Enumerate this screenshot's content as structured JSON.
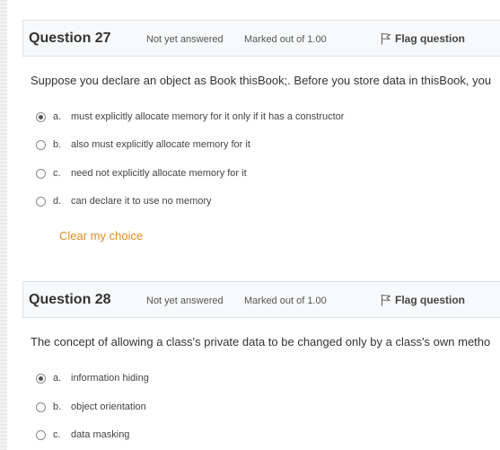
{
  "questions": [
    {
      "title": "Question 27",
      "state": "Not yet answered",
      "grade": "Marked out of 1.00",
      "flag_label": "Flag question",
      "text": "Suppose you declare an object as Book thisBook;. Before you store data in thisBook, you",
      "answers": [
        {
          "letter": "a.",
          "text": "must explicitly allocate memory for it only if it has a constructor",
          "selected": true
        },
        {
          "letter": "b.",
          "text": "also must explicitly allocate memory for it",
          "selected": false
        },
        {
          "letter": "c.",
          "text": "need not explicitly allocate memory for it",
          "selected": false
        },
        {
          "letter": "d.",
          "text": "can declare it to use no memory",
          "selected": false
        }
      ],
      "clear_label": "Clear my choice"
    },
    {
      "title": "Question 28",
      "state": "Not yet answered",
      "grade": "Marked out of 1.00",
      "flag_label": "Flag question",
      "text": "The concept of allowing a class's private data to be changed only by a class's own metho",
      "answers": [
        {
          "letter": "a.",
          "text": "information hiding",
          "selected": true
        },
        {
          "letter": "b.",
          "text": "object orientation",
          "selected": false
        },
        {
          "letter": "c.",
          "text": "data masking",
          "selected": false
        }
      ]
    }
  ],
  "colors": {
    "header_bg": "#f8f9fa",
    "border": "#dee2e6",
    "link_orange": "#e28a1e",
    "text": "#333333"
  }
}
